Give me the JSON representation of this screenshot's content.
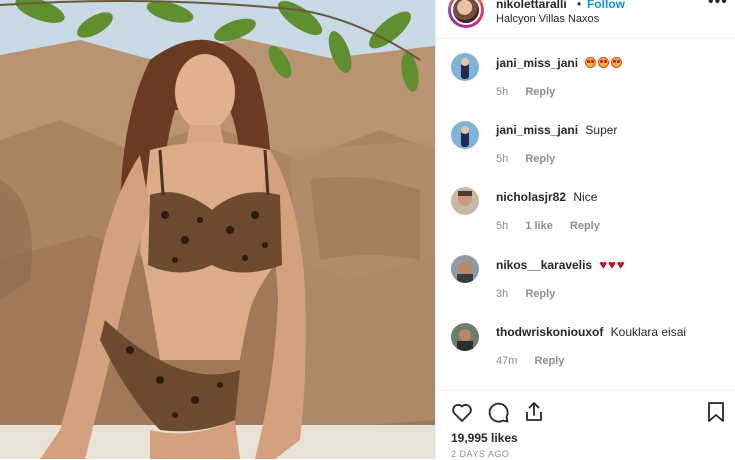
{
  "header": {
    "username": "nikolettaralli",
    "separator": "•",
    "follow_label": "Follow",
    "location": "Halcyon Villas Naxos",
    "more_label": "•••"
  },
  "comments": [
    {
      "username": "jani_miss_jani",
      "text": "",
      "emoji": "star-struck-face x3",
      "time": "5h",
      "likes": "",
      "reply": "Reply"
    },
    {
      "username": "jani_miss_jani",
      "text": "Super",
      "emoji": "",
      "time": "5h",
      "likes": "",
      "reply": "Reply"
    },
    {
      "username": "nicholasjr82",
      "text": "Nice",
      "emoji": "",
      "time": "5h",
      "likes": "1 like",
      "reply": "Reply"
    },
    {
      "username": "nikos__karavelis",
      "text": "",
      "emoji": "red-heart x3",
      "time": "3h",
      "likes": "",
      "reply": "Reply"
    },
    {
      "username": "thodwriskoniouxof",
      "text": "Kouklara eisai",
      "emoji": "",
      "time": "47m",
      "likes": "",
      "reply": "Reply"
    }
  ],
  "icons": {
    "like": "heart-icon",
    "comment": "comment-icon",
    "share": "share-icon",
    "save": "bookmark-icon",
    "more": "more-icon"
  },
  "footer": {
    "likes": "19,995 likes",
    "time_ago": "2 DAYS AGO"
  },
  "colors": {
    "accent": "#0095f6",
    "text": "#262626",
    "muted": "#8e8e8e",
    "divider": "#efefef"
  }
}
